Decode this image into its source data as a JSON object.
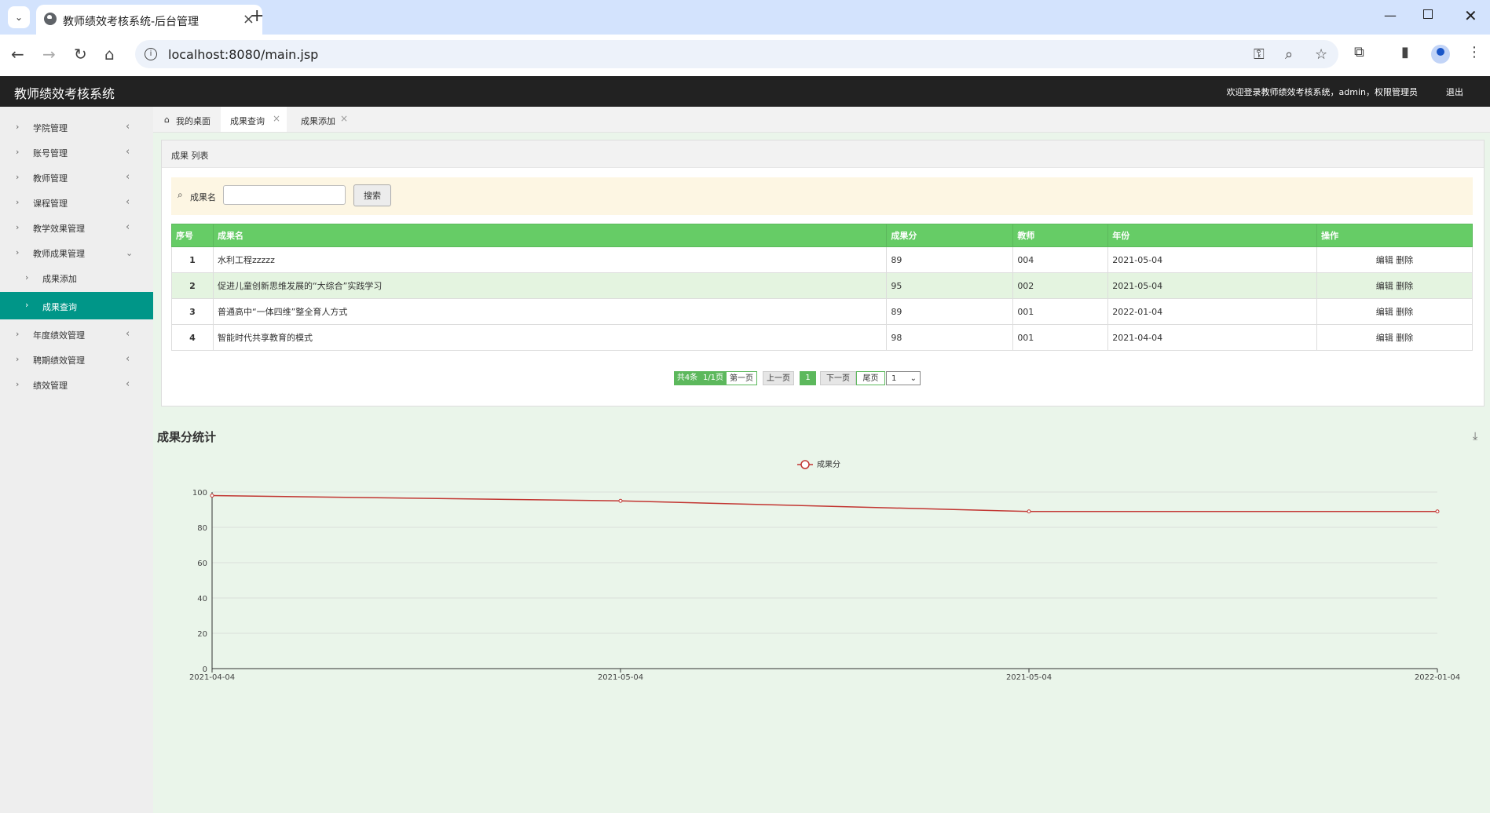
{
  "browser": {
    "tab_title": "教师绩效考核系统-后台管理",
    "url": "localhost:8080/main.jsp"
  },
  "app": {
    "title": "教师绩效考核系统",
    "welcome": "欢迎登录教师绩效考核系统，admin，权限管理员",
    "logout": "退出"
  },
  "sidebar": {
    "items": [
      {
        "label": "学院管理"
      },
      {
        "label": "账号管理"
      },
      {
        "label": "教师管理"
      },
      {
        "label": "课程管理"
      },
      {
        "label": "教学效果管理"
      },
      {
        "label": "教师成果管理"
      },
      {
        "label": "成果添加"
      },
      {
        "label": "成果查询"
      },
      {
        "label": "年度绩效管理"
      },
      {
        "label": "聘期绩效管理"
      },
      {
        "label": "绩效管理"
      }
    ]
  },
  "tabs": {
    "home": "我的桌面",
    "query": "成果查询",
    "add": "成果添加"
  },
  "panel": {
    "title": "成果 列表",
    "search_label": "成果名",
    "search_button": "搜索"
  },
  "table": {
    "headers": [
      "序号",
      "成果名",
      "成果分",
      "教师",
      "年份",
      "操作"
    ],
    "rows": [
      {
        "no": "1",
        "name": "水利工程zzzzz",
        "score": "89",
        "teacher": "004",
        "year": "2021-05-04",
        "edit": "编辑",
        "del": "删除"
      },
      {
        "no": "2",
        "name": "促进儿童创新思维发展的“大综合”实践学习",
        "score": "95",
        "teacher": "002",
        "year": "2021-05-04",
        "edit": "编辑",
        "del": "删除"
      },
      {
        "no": "3",
        "name": "普通高中“一体四维”整全育人方式",
        "score": "89",
        "teacher": "001",
        "year": "2022-01-04",
        "edit": "编辑",
        "del": "删除"
      },
      {
        "no": "4",
        "name": "智能时代共享教育的模式",
        "score": "98",
        "teacher": "001",
        "year": "2021-04-04",
        "edit": "编辑",
        "del": "删除"
      }
    ]
  },
  "pager": {
    "total": "共4条",
    "pages": "1/1页",
    "first": "第一页",
    "prev": "上一页",
    "current": "1",
    "next": "下一页",
    "last": "尾页",
    "select": "1"
  },
  "colors": {
    "accent": "#009688",
    "header_green": "#66cc66",
    "line": "#c23531"
  },
  "chart_data": {
    "type": "line",
    "title": "成果分统计",
    "categories": [
      "2021-04-04",
      "2021-05-04",
      "2021-05-04",
      "2022-01-04"
    ],
    "series": [
      {
        "name": "成果分",
        "values": [
          98,
          95,
          89,
          89
        ]
      }
    ],
    "y_ticks": [
      "0",
      "20",
      "40",
      "60",
      "80",
      "100"
    ],
    "ylim": [
      0,
      100
    ],
    "legend": "top-center",
    "grid": true
  }
}
